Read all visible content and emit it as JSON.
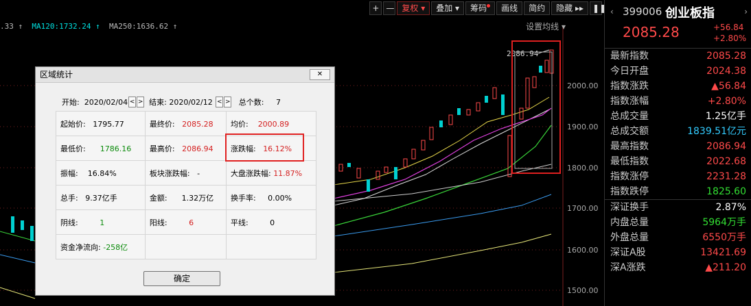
{
  "toolbar": {
    "plus": "+",
    "minus": "—",
    "fuquan": "复权 ▾",
    "diejia": "叠加 ▾",
    "chouma": "筹码",
    "huaxian": "画线",
    "jianyue": "简约",
    "yincang": "隐藏 ▸▸",
    "pause": "❚❚"
  },
  "ma_bar": {
    "prefix": ".33 ↑",
    "ma120": "MA120:1732.24 ↑",
    "ma250": "MA250:1636.62 ↑"
  },
  "settings_label": "设置均线 ▾",
  "chart_labels": {
    "high_mark": "2086.94",
    "p2000": "2000.00",
    "p1900": "1900.00",
    "p1800": "1800.00",
    "p1700": "1700.00",
    "p1600": "1600.00",
    "p1500": "1500.00"
  },
  "dialog": {
    "title": "区域统计",
    "close_label": "✕",
    "start_label": "开始:",
    "start_value": "2020/02/04",
    "end_label": "结束:",
    "end_value": "2020/02/12",
    "count_label": "总个数:",
    "count_value": "7",
    "cells": {
      "open_label": "起始价:",
      "open_value": "1795.77",
      "final_label": "最终价:",
      "final_value": "2085.28",
      "avg_label": "均价:",
      "avg_value": "2000.89",
      "low_label": "最低价:",
      "low_value": "1786.16",
      "high_label": "最高价:",
      "high_value": "2086.94",
      "chg_label": "涨跌幅:",
      "chg_value": "16.12%",
      "amp_label": "振幅:",
      "amp_value": "16.84%",
      "block_label": "板块涨跌幅:",
      "block_value": "-",
      "market_label": "大盘涨跌幅:",
      "market_value": "11.87%",
      "vol_label": "总手:",
      "vol_value": "9.37亿手",
      "amt_label": "金额:",
      "amt_value": "1.32万亿",
      "turn_label": "换手率:",
      "turn_value": "0.00%",
      "yin_label": "阴线:",
      "yin_value": "1",
      "yang_label": "阳线:",
      "yang_value": "6",
      "flat_label": "平线:",
      "flat_value": "0",
      "flow_label": "资金净流向:",
      "flow_value": "-258亿"
    },
    "ok_label": "确定"
  },
  "panel": {
    "left_arrow": "‹",
    "right_arrow": "›",
    "code": "399006",
    "name": "创业板指",
    "price": "2085.28",
    "change": "+56.84",
    "change_pct": "+2.80%",
    "rows": [
      {
        "label": "最新指数",
        "value": "2085.28",
        "color": "r"
      },
      {
        "label": "今日开盘",
        "value": "2024.38",
        "color": "r"
      },
      {
        "label": "指数涨跌",
        "value": "▲56.84",
        "color": "r"
      },
      {
        "label": "指数涨幅",
        "value": "+2.80%",
        "color": "r"
      },
      {
        "label": "总成交量",
        "value": "1.25亿手",
        "color": "w"
      },
      {
        "label": "总成交额",
        "value": "1839.51亿元",
        "color": "cy"
      },
      {
        "label": "最高指数",
        "value": "2086.94",
        "color": "r"
      },
      {
        "label": "最低指数",
        "value": "2022.68",
        "color": "r"
      },
      {
        "label": "指数涨停",
        "value": "2231.28",
        "color": "r"
      },
      {
        "label": "指数跌停",
        "value": "1825.60",
        "color": "g"
      },
      {
        "label": "深证换手",
        "value": "2.87%",
        "color": "w"
      },
      {
        "label": "内盘总量",
        "value": "5964万手",
        "color": "g"
      },
      {
        "label": "外盘总量",
        "value": "6550万手",
        "color": "r"
      },
      {
        "label": "深证A股",
        "value": "13421.69",
        "color": "r"
      },
      {
        "label": "深A涨跌",
        "value": "▲211.20",
        "color": "r"
      }
    ]
  }
}
